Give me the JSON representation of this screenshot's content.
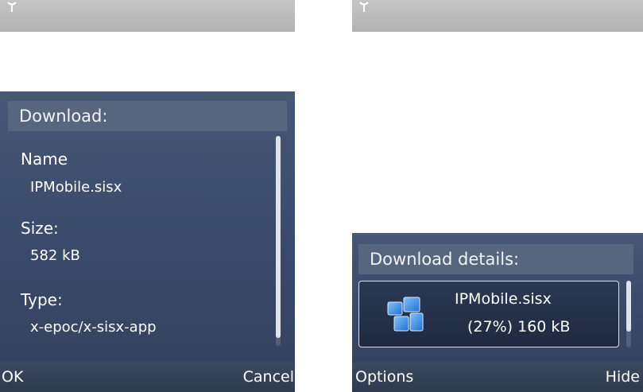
{
  "left_screen": {
    "dialog_title": "Download:",
    "fields": [
      {
        "label": "Name",
        "value": "IPMobile.sisx"
      },
      {
        "label": "Size:",
        "value": "582 kB"
      },
      {
        "label": "Type:",
        "value": "x-epoc/x-sisx-app"
      }
    ],
    "softkeys": {
      "left": "OK",
      "right": "Cancel"
    }
  },
  "right_screen": {
    "dialog_title": "Download details:",
    "download": {
      "name": "IPMobile.sisx",
      "progress_text": "(27%) 160 kB",
      "progress_percent": 27
    },
    "softkeys": {
      "left": "Options",
      "right": "Hide"
    }
  },
  "icons": {
    "signal": "signal-antenna-icon",
    "installer": "sis-installer-icon"
  },
  "colors": {
    "dialog_bg": "#3a4b6b",
    "title_bar": "#56667f",
    "status_bar": "#bcbcbc",
    "text": "#ffffff"
  }
}
